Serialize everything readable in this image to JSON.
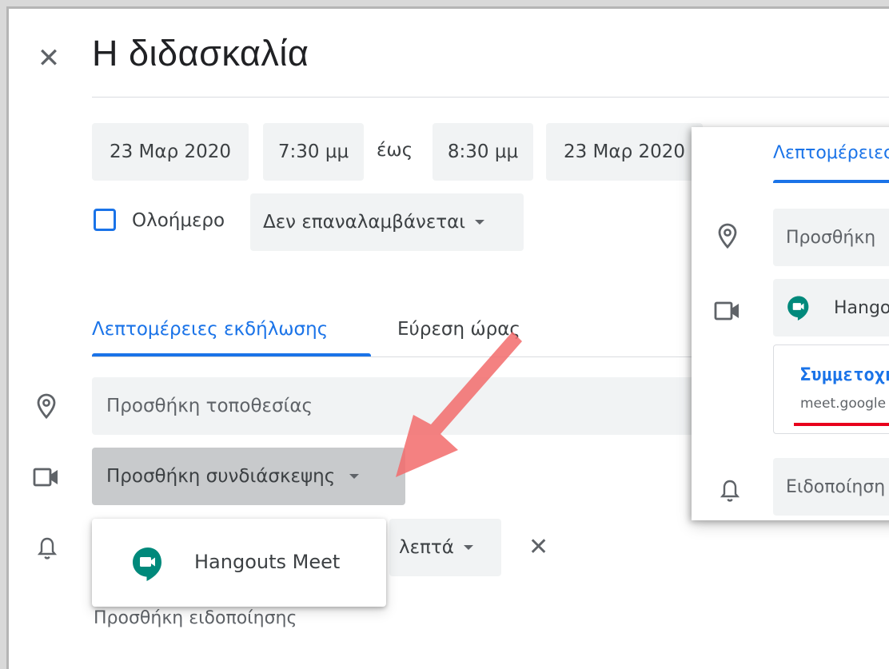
{
  "event": {
    "title": "Η διδασκαλία",
    "start_date": "23 Μαρ 2020",
    "start_time": "7:30 μμ",
    "to_label": "έως",
    "end_time": "8:30 μμ",
    "end_date": "23 Μαρ 2020",
    "all_day_label": "Ολοήμερο",
    "all_day_checked": false,
    "repeat_value": "Δεν επαναλαμβάνεται"
  },
  "tabs": [
    {
      "label": "Λεπτομέρειες εκδήλωσης",
      "active": true
    },
    {
      "label": "Εύρεση ώρας",
      "active": false
    }
  ],
  "details": {
    "location_placeholder": "Προσθήκη τοποθεσίας",
    "conference_button": "Προσθήκη συνδιάσκεψης",
    "notification_unit": "λεπτά",
    "add_notification": "Προσθήκη ειδοποίησης"
  },
  "dropdown": {
    "items": [
      {
        "label": "Hangouts Meet",
        "icon": "hangouts-meet-icon"
      }
    ]
  },
  "inset_panel": {
    "tab_label": "Λεπτομέρειες",
    "location_placeholder": "Προσθήκη",
    "conference_label": "Hangouts",
    "join_label": "Συμμετοχή",
    "join_link": "meet.google",
    "notification_label": "Ειδοποίηση"
  },
  "colors": {
    "accent": "#1a73e8",
    "meet_green": "#00897b",
    "highlight_arrow": "#f26b6b",
    "underline_red": "#e8001c"
  }
}
